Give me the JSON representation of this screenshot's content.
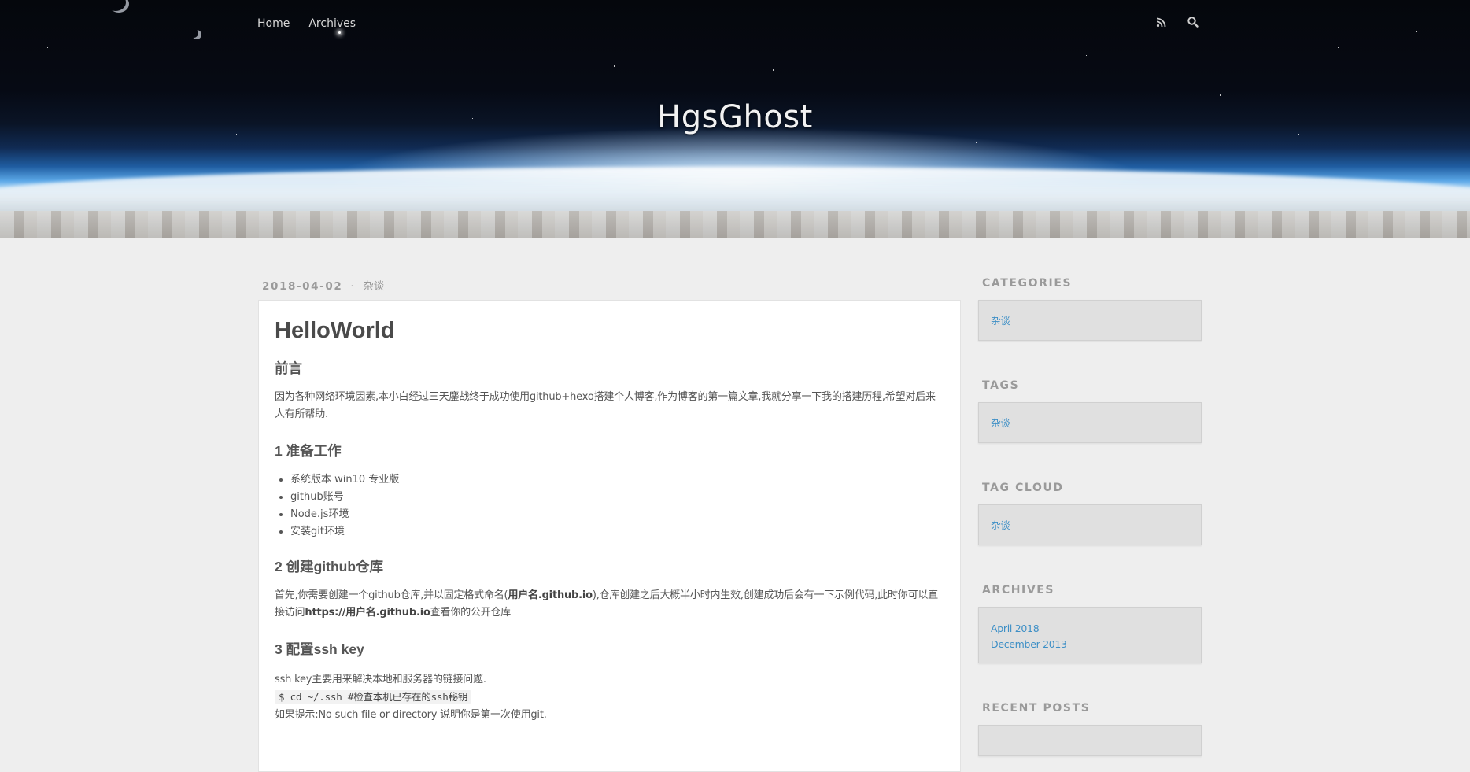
{
  "nav": {
    "links": [
      "Home",
      "Archives"
    ],
    "icons": [
      "rss-icon",
      "search-icon"
    ]
  },
  "site": {
    "title": "HgsGhost"
  },
  "post": {
    "date": "2018-04-02",
    "separator": "·",
    "category": "杂谈",
    "title": "HelloWorld",
    "intro_heading": "前言",
    "intro_text": "因为各种网络环境因素,本小白经过三天鏖战终于成功使用github+hexo搭建个人博客,作为博客的第一篇文章,我就分享一下我的搭建历程,希望对后来人有所帮助.",
    "section1_heading": "1 准备工作",
    "section1_items": [
      "系统版本 win10 专业版",
      "github账号",
      "Node.js环境",
      "安装git环境"
    ],
    "section2_heading": "2 创建github仓库",
    "section2_text_a": "首先,你需要创建一个github仓库,并以固定格式命名(",
    "section2_bold_a": "用户名.github.io",
    "section2_text_b": "),仓库创建之后大概半小时内生效,创建成功后会有一下示例代码,此时你可以直接访问",
    "section2_bold_b": "https://用户名.github.io",
    "section2_text_c": "查看你的公开仓库",
    "section3_heading": "3 配置ssh key",
    "section3_text": "ssh key主要用来解决本地和服务器的链接问题.",
    "section3_code": "$ cd ~/.ssh #检查本机已存在的ssh秘钥",
    "section3_text2": "如果提示:No such file or directory 说明你是第一次使用git."
  },
  "sidebar": {
    "categories": {
      "heading": "CATEGORIES",
      "items": [
        "杂谈"
      ]
    },
    "tags": {
      "heading": "TAGS",
      "items": [
        "杂谈"
      ]
    },
    "tag_cloud": {
      "heading": "TAG CLOUD",
      "items": [
        "杂谈"
      ]
    },
    "archives": {
      "heading": "ARCHIVES",
      "items": [
        "April 2018",
        "December 2013"
      ]
    },
    "recent_posts": {
      "heading": "RECENT POSTS"
    }
  },
  "colors": {
    "link": "#3d8fc6",
    "background": "#eeeeee",
    "sidebar_box": "#e0e0e0"
  }
}
